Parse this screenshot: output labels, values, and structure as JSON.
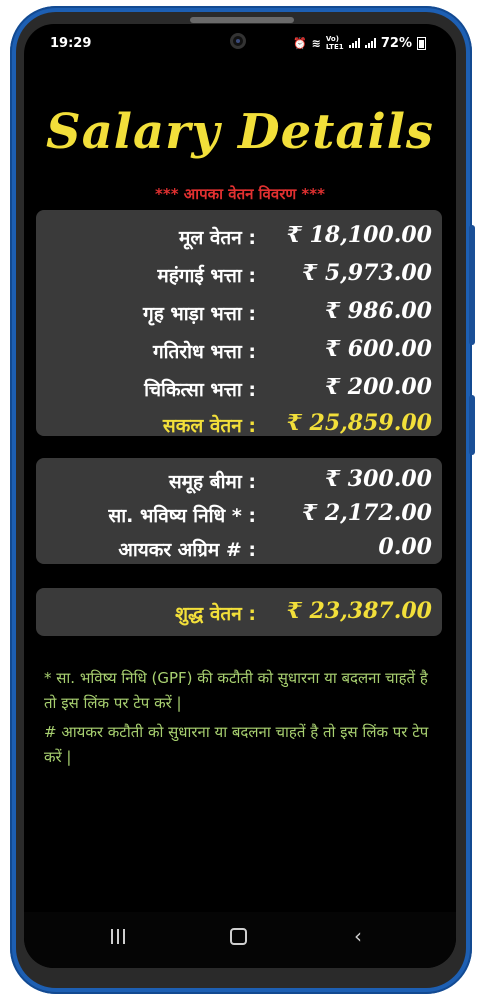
{
  "status_bar": {
    "time": "19:29",
    "network": "Vo) LTE1",
    "battery": "72%"
  },
  "header": {
    "title": "Salary Details",
    "subtitle": "*** आपका वेतन विवरण ***"
  },
  "earnings": [
    {
      "label": "मूल वेतन :",
      "value": "₹ 18,100.00"
    },
    {
      "label": "महंगाई भत्ता :",
      "value": "₹ 5,973.00"
    },
    {
      "label": "गृह भाड़ा भत्ता :",
      "value": "₹ 986.00"
    },
    {
      "label": "गतिरोध भत्ता :",
      "value": "₹ 600.00"
    },
    {
      "label": "चिकित्सा भत्ता  :",
      "value": "₹ 200.00"
    }
  ],
  "gross": {
    "label": "सकल वेतन :",
    "value": "₹ 25,859.00"
  },
  "deductions": [
    {
      "label": "समूह बीमा  :",
      "value": "₹ 300.00"
    },
    {
      "label": "सा. भविष्य निधि * :",
      "value": "₹ 2,172.00"
    },
    {
      "label": "आयकर अग्रिम # :",
      "value": "0.00"
    }
  ],
  "net": {
    "label": "शुद्ध वेतन  :",
    "value": "₹ 23,387.00"
  },
  "notes": [
    "* सा. भविष्य निधि (GPF)  की कटौती को सुधारना या बदलना चाहतें है तो इस लिंक पर टेप करें |",
    "# आयकर कटौती को सुधारना या बदलना चाहतें है तो इस लिंक पर टेप करें |"
  ],
  "colors": {
    "title": "#f2df3a",
    "subtitle": "#e03030",
    "card": "#3a3a3a",
    "note": "#a8d070",
    "frame": "#1d5fb3"
  }
}
